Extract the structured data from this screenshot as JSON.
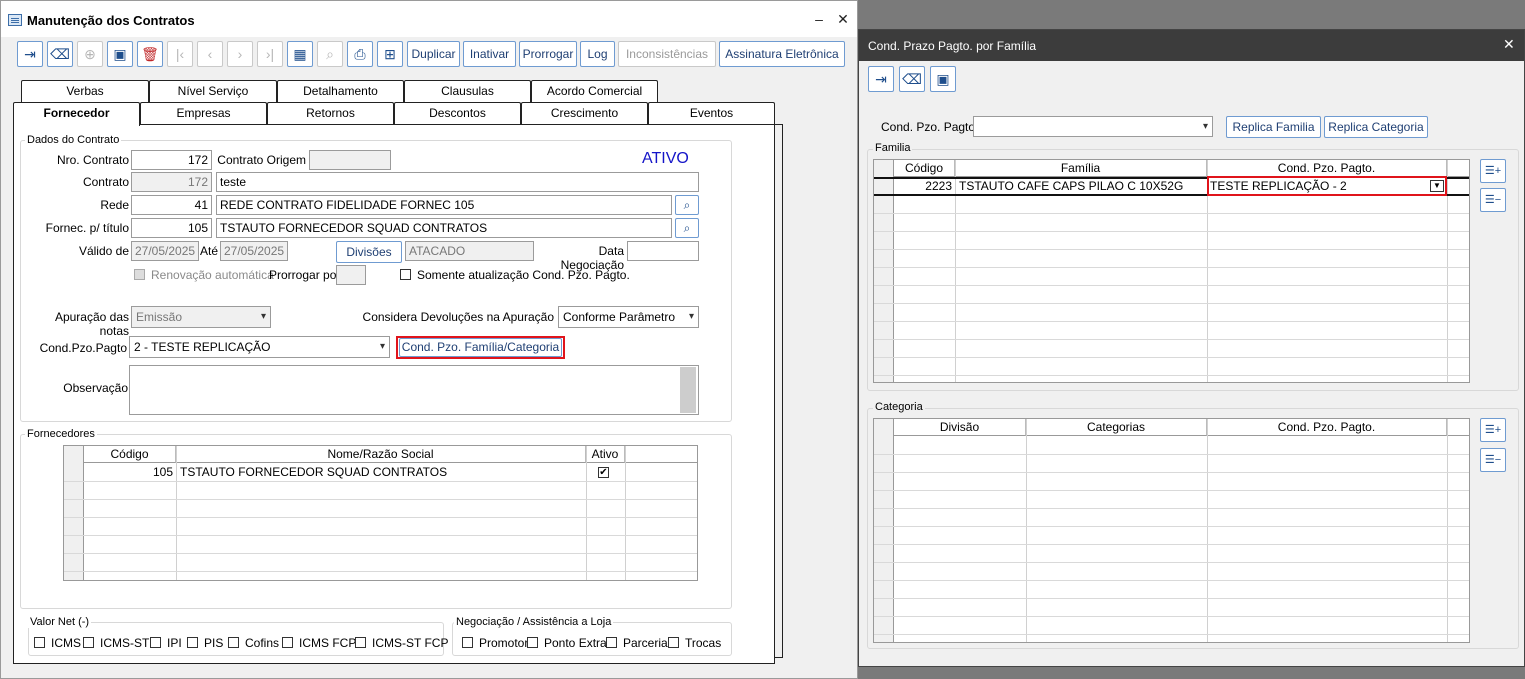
{
  "main_window": {
    "title": "Manutenção dos Contratos",
    "minimize": "–",
    "close": "✕",
    "toolbar": {
      "duplicar": "Duplicar",
      "inativar": "Inativar",
      "prorrogar": "Prorrogar",
      "log": "Log",
      "inconsistencias": "Inconsistências",
      "assinatura": "Assinatura Eletrônica"
    },
    "tabs_row1": [
      "Verbas",
      "Nível Serviço",
      "Detalhamento",
      "Clausulas",
      "Acordo Comercial"
    ],
    "tabs_row2": [
      "Fornecedor",
      "Empresas",
      "Retornos",
      "Descontos",
      "Crescimento",
      "Eventos"
    ],
    "dados": {
      "group_label": "Dados do Contrato",
      "nro_contrato_label": "Nro. Contrato",
      "nro_contrato": "172",
      "contrato_origem_label": "Contrato Origem",
      "contrato_origem": "",
      "status": "ATIVO",
      "contrato_label": "Contrato",
      "contrato_num": "172",
      "contrato_desc": "teste",
      "rede_label": "Rede",
      "rede_code": "41",
      "rede_desc": "REDE CONTRATO FIDELIDADE FORNEC 105",
      "fornec_label": "Fornec. p/ título",
      "fornec_code": "105",
      "fornec_desc": "TSTAUTO FORNECEDOR SQUAD CONTRATOS",
      "valido_label": "Válido de",
      "valido_de": "27/05/2025",
      "ate_label": "Até",
      "ate": "27/05/2025",
      "divisoes_button": "Divisões",
      "divisao": "ATACADO",
      "data_neg_label": "Data Negociação",
      "data_neg": "",
      "renovacao_label": "Renovação automática",
      "prorrogar_por_label": "Prorrogar por",
      "prorrogar_por": "",
      "somente_label": "Somente atualização Cond. Pzo. Pagto.",
      "apuracao_label": "Apuração das notas",
      "apuracao": "Emissão",
      "considera_label": "Considera Devoluções na Apuração",
      "considera": "Conforme Parâmetro",
      "cond_label": "Cond.Pzo.Pagto",
      "cond": "2 - TESTE REPLICAÇÃO",
      "cond_familia_button": "Cond. Pzo. Família/Categoria",
      "observacao_label": "Observação",
      "observacao": ""
    },
    "fornecedores": {
      "group_label": "Fornecedores",
      "columns": [
        "Código",
        "Nome/Razão Social",
        "Ativo"
      ],
      "rows": [
        {
          "codigo": "105",
          "nome": "TSTAUTO FORNECEDOR SQUAD CONTRATOS",
          "ativo": "✔"
        }
      ]
    },
    "valor_net": {
      "group_label": "Valor Net (-)",
      "items": [
        "ICMS",
        "ICMS-ST",
        "IPI",
        "PIS",
        "Cofins",
        "ICMS FCP",
        "ICMS-ST FCP"
      ]
    },
    "negociacao": {
      "group_label": "Negociação / Assistência a Loja",
      "items": [
        "Promotor",
        "Ponto Extra",
        "Parceria",
        "Trocas"
      ]
    }
  },
  "dialog": {
    "title": "Cond. Prazo Pagto. por Família",
    "close": "✕",
    "cond_label": "Cond. Pzo. Pagto.",
    "cond_value": "",
    "replica_familia": "Replica Familia",
    "replica_categoria": "Replica Categoria",
    "familia": {
      "group_label": "Familia",
      "columns": [
        "Código",
        "Família",
        "Cond. Pzo. Pagto."
      ],
      "rows": [
        {
          "codigo": "2223",
          "familia": "TSTAUTO CAFE CAPS PILAO C 10X52G",
          "cond": "TESTE REPLICAÇÃO - 2"
        }
      ]
    },
    "categoria": {
      "group_label": "Categoria",
      "columns": [
        "Divisão",
        "Categorias",
        "Cond. Pzo. Pagto."
      ]
    }
  },
  "colors": {
    "accent": "#1f4e8c",
    "highlight": "#e0141b",
    "status": "#1414c8"
  }
}
